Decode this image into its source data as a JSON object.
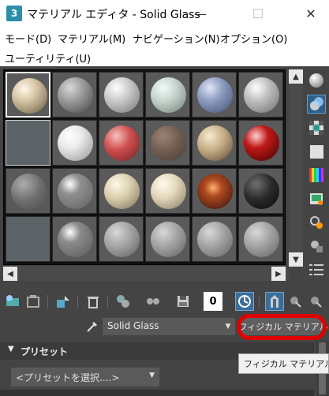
{
  "window": {
    "app_icon": "3",
    "title": "マテリアル エディタ - Solid Glass",
    "min": "—",
    "max": "☐",
    "close": "✕"
  },
  "menu": [
    "モード(D)",
    "マテリアル(M)",
    "ナビゲーション(N)",
    "オプション(O)",
    "ユーティリティ(U)"
  ],
  "toolbar": {
    "count_value": "0"
  },
  "material": {
    "name": "Solid Glass",
    "type_button": "フィジカル マテリアル"
  },
  "rollout": {
    "title": "プリセット",
    "preset_placeholder": "<プリセットを選択....>"
  },
  "tooltip": "フィジカル マテリアル"
}
